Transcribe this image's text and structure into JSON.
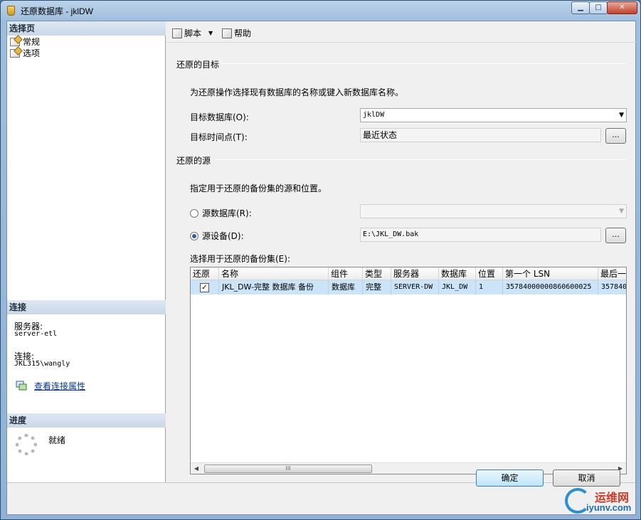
{
  "window": {
    "title": "还原数据库 - jklDW",
    "min_glyph": "▁",
    "max_glyph": "□",
    "close_glyph": "✕"
  },
  "left_panel": {
    "select_page_header": "选择页",
    "pages": [
      {
        "label": "常规",
        "icon": "page-icon"
      },
      {
        "label": "选项",
        "icon": "page-icon"
      }
    ],
    "connection_header": "连接",
    "server_label": "服务器:",
    "server_value": "server-etl",
    "connection_label": "连接:",
    "connection_value": "JKL315\\wangly",
    "view_connection_link": "查看连接属性",
    "progress_header": "进度",
    "progress_status": "就绪"
  },
  "toolbar": {
    "script_label": "脚本",
    "help_label": "帮助"
  },
  "restore_target": {
    "group_title": "还原的目标",
    "description": "为还原操作选择现有数据库的名称或键入新数据库名称。",
    "target_db_label": "目标数据库(O):",
    "target_db_value": "jklDW",
    "target_time_label": "目标时间点(T):",
    "target_time_value": "最近状态",
    "browse_label": "..."
  },
  "restore_source": {
    "group_title": "还原的源",
    "description": "指定用于还原的备份集的源和位置。",
    "source_db_label": "源数据库(R):",
    "source_db_value": "",
    "source_device_label": "源设备(D):",
    "source_device_value": "E:\\JKL_DW.bak",
    "browse_label": "...",
    "selected_radio": "source_device"
  },
  "backup_sets": {
    "label": "选择用于还原的备份集(E):",
    "columns": [
      "还原",
      "名称",
      "组件",
      "类型",
      "服务器",
      "数据库",
      "位置",
      "第一个 LSN",
      "最后一"
    ],
    "rows": [
      {
        "restore": true,
        "name": "JKL_DW-完整 数据库 备份",
        "component": "数据库",
        "type": "完整",
        "server": "SERVER-DW",
        "database": "JKL_DW",
        "position": "1",
        "first_lsn": "35784000000860600025",
        "last_lsn": "357840"
      }
    ],
    "scroll_thumb_glyph": "III"
  },
  "buttons": {
    "ok": "确定",
    "cancel": "取消"
  },
  "watermark": {
    "cn": "运维网",
    "en": "iyunv.com"
  }
}
